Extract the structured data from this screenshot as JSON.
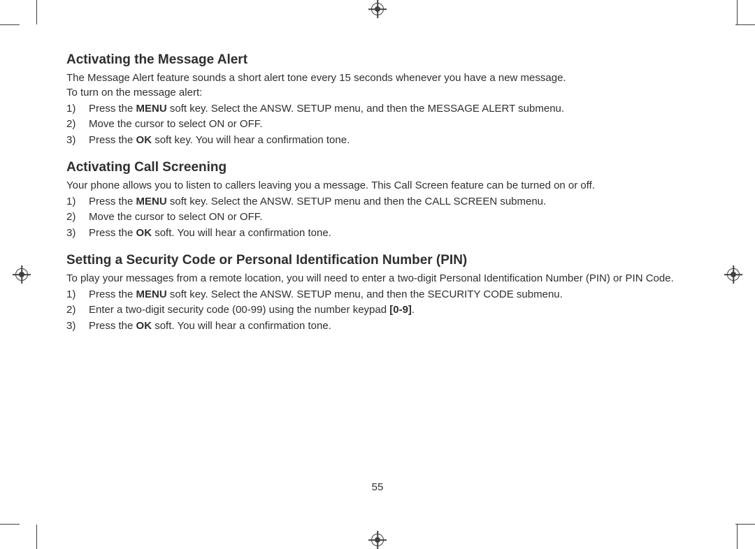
{
  "page_number": "55",
  "sections": [
    {
      "heading": "Activating the Message Alert",
      "intro1": "The Message Alert feature sounds a short alert tone every 15 seconds whenever you have a new message.",
      "intro2": "To turn on the message alert:",
      "steps": [
        {
          "pre": "Press the ",
          "bold": "MENU",
          "post": " soft key. Select the ANSW. SETUP menu, and then the MESSAGE ALERT submenu."
        },
        {
          "pre": "Move the cursor to select ON or OFF.",
          "bold": "",
          "post": ""
        },
        {
          "pre": "Press the ",
          "bold": "OK",
          "post": " soft key. You will hear a confirmation tone."
        }
      ]
    },
    {
      "heading": "Activating Call Screening",
      "intro1": "Your phone allows you to listen to callers leaving you a message. This Call Screen feature can be turned on or off.",
      "intro2": "",
      "steps": [
        {
          "pre": "Press the ",
          "bold": "MENU",
          "post": " soft key. Select the ANSW. SETUP menu and then the CALL SCREEN submenu."
        },
        {
          "pre": "Move the cursor to select ON or OFF.",
          "bold": "",
          "post": ""
        },
        {
          "pre": "Press the ",
          "bold": "OK",
          "post": " soft. You will hear a confirmation tone."
        }
      ]
    },
    {
      "heading": "Setting a Security Code or Personal Identification Number (PIN)",
      "intro1": "To play your messages from a remote location, you will need to enter a two-digit Personal Identification Number (PIN) or PIN Code.",
      "intro2": "",
      "steps": [
        {
          "pre": "Press the ",
          "bold": "MENU",
          "post": " soft key. Select the ANSW. SETUP menu, and then the SECURITY CODE submenu."
        },
        {
          "pre": "Enter a two-digit security code (00-99) using the number keypad ",
          "bold": "[0-9]",
          "post": "."
        },
        {
          "pre": "Press the ",
          "bold": "OK",
          "post": " soft. You will hear a confirmation tone."
        }
      ]
    }
  ]
}
